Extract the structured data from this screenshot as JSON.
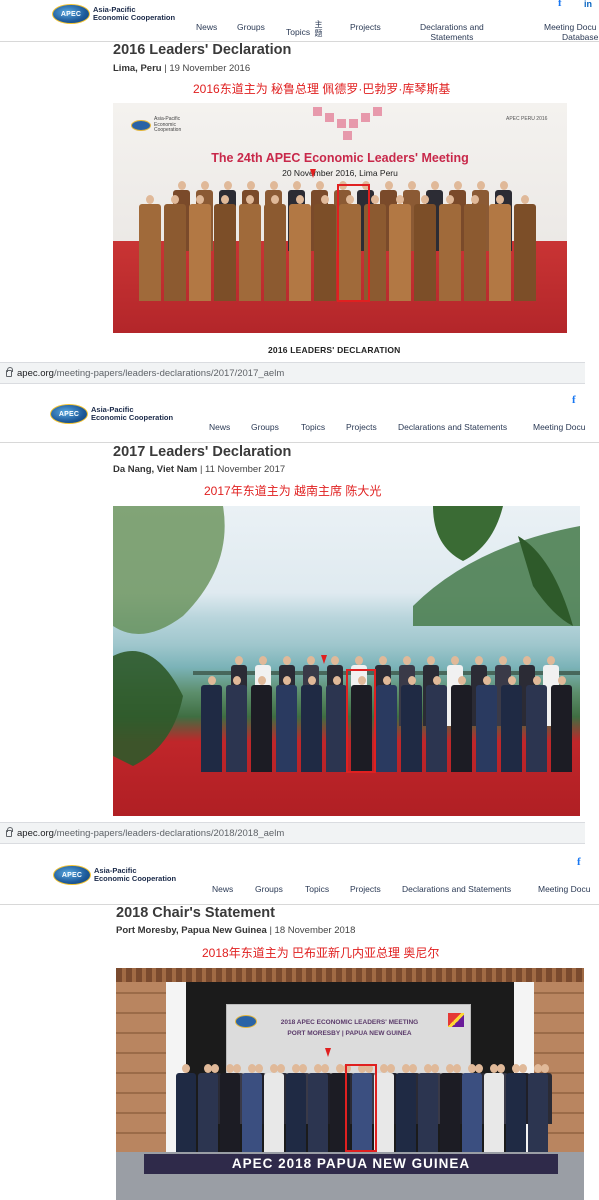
{
  "nav": {
    "logo_mark": "APEC",
    "logo_line1": "Asia-Pacific",
    "logo_line2": "Economic Cooperation",
    "panel1_items": [
      "News",
      "Groups",
      "Topics",
      "主题",
      "Projects",
      "Declarations and",
      "Statements",
      "Meeting Docu",
      "Database"
    ],
    "panel2_items": [
      "News",
      "Groups",
      "Topics",
      "Projects",
      "Declarations and Statements",
      "Meeting Docu"
    ],
    "panel3_items": [
      "News",
      "Groups",
      "Topics",
      "Projects",
      "Declarations and Statements",
      "Meeting Docu"
    ],
    "facebook": "f",
    "linkedin": "in"
  },
  "panels": [
    {
      "title": "2016 Leaders' Declaration",
      "place": "Lima, Peru",
      "date": "| 19 November 2016",
      "annotation": "2016东道主为 秘鲁总理 佩德罗·巴勃罗·库琴斯基",
      "photo": {
        "logo_left": "Asia-Pacific Economic Cooperation",
        "logo_right": "APEC PERU 2016",
        "banner_title": "The 24th APEC Economic Leaders' Meeting",
        "banner_sub": "20 November 2016, Lima Peru"
      },
      "caption": "2016 LEADERS' DECLARATION"
    },
    {
      "title": "2017 Leaders' Declaration",
      "place": "Da Nang, Viet Nam",
      "date": "| 11 November 2017",
      "annotation": "2017年东道主为 越南主席 陈大光"
    },
    {
      "title": "2018 Chair's Statement",
      "place": "Port Moresby, Papua New Guinea",
      "date": "| 18 November 2018",
      "annotation": "2018年东道主为 巴布亚新几内亚总理 奥尼尔",
      "photo": {
        "backdrop_line1": "2018 APEC ECONOMIC LEADERS' MEETING",
        "backdrop_line2": "PORT MORESBY | PAPUA NEW GUINEA",
        "stage_banner": "APEC 2018 PAPUA NEW GUINEA"
      }
    }
  ],
  "urls": [
    {
      "host": "apec.org",
      "path": "/meeting-papers/leaders-declarations/2017/2017_aelm"
    },
    {
      "host": "apec.org",
      "path": "/meeting-papers/leaders-declarations/2018/2018_aelm"
    }
  ],
  "colors": {
    "annotation_red": "#e02020",
    "nav_text": "#2b3a55",
    "title_gray": "#3a3a3a"
  }
}
